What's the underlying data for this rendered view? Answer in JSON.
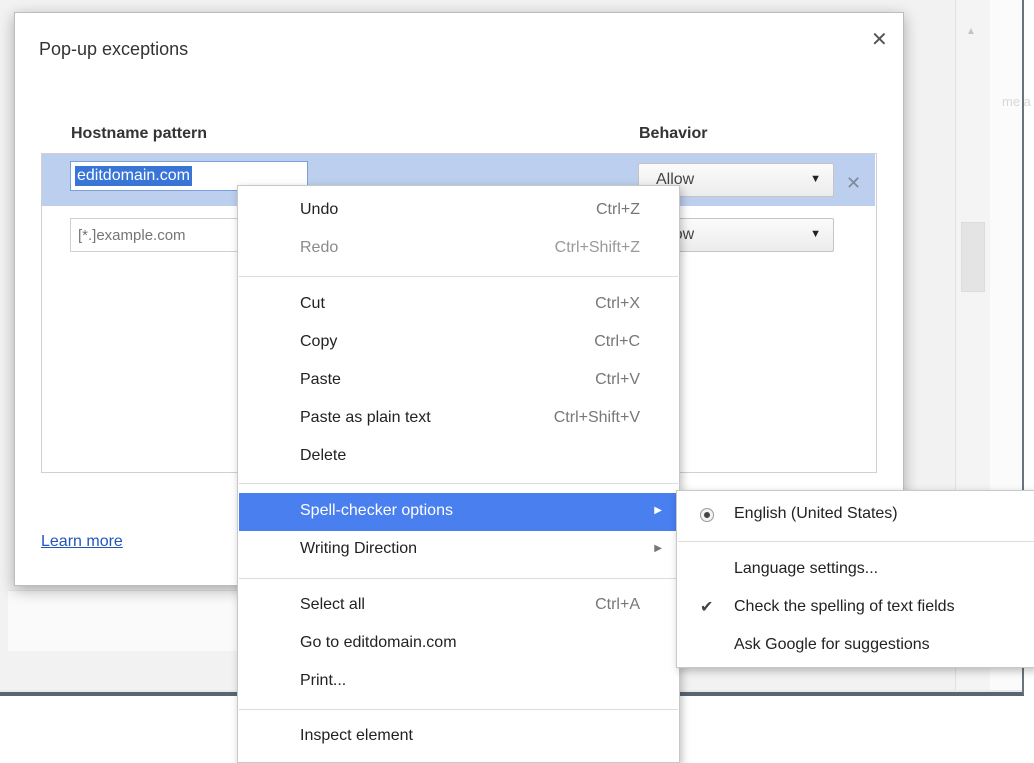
{
  "dialog": {
    "title": "Pop-up exceptions",
    "close_glyph": "✕",
    "columns": {
      "hostname": "Hostname pattern",
      "behavior": "Behavior"
    },
    "rows": [
      {
        "hostname": "editdomain.com",
        "behavior": "Allow",
        "remove_glyph": "✕"
      },
      {
        "hostname": "",
        "behavior": "Allow"
      }
    ],
    "new_host_placeholder": "[*.]example.com",
    "learn_more": "Learn more"
  },
  "context_menu": {
    "items": [
      {
        "label": "Undo",
        "shortcut": "Ctrl+Z",
        "enabled": true
      },
      {
        "label": "Redo",
        "shortcut": "Ctrl+Shift+Z",
        "enabled": false
      },
      {
        "label": "Cut",
        "shortcut": "Ctrl+X",
        "enabled": true
      },
      {
        "label": "Copy",
        "shortcut": "Ctrl+C",
        "enabled": true
      },
      {
        "label": "Paste",
        "shortcut": "Ctrl+V",
        "enabled": true
      },
      {
        "label": "Paste as plain text",
        "shortcut": "Ctrl+Shift+V",
        "enabled": true
      },
      {
        "label": "Delete",
        "shortcut": "",
        "enabled": true
      },
      {
        "label": "Spell-checker options",
        "shortcut": "",
        "enabled": true,
        "submenu": true,
        "highlighted": true
      },
      {
        "label": "Writing Direction",
        "shortcut": "",
        "enabled": true,
        "submenu": true
      },
      {
        "label": "Select all",
        "shortcut": "Ctrl+A",
        "enabled": true
      },
      {
        "label": "Go to editdomain.com",
        "shortcut": "",
        "enabled": true
      },
      {
        "label": "Print...",
        "shortcut": "",
        "enabled": true
      },
      {
        "label": "Inspect element",
        "shortcut": "",
        "enabled": true
      }
    ],
    "submenu_arrow": "▶"
  },
  "spell_submenu": {
    "items": [
      {
        "label": "English (United States)",
        "mark": "radio"
      },
      {
        "label": "Language settings...",
        "mark": ""
      },
      {
        "label": "Check the spelling of text fields",
        "mark": "check",
        "check_glyph": "✔"
      },
      {
        "label": "Ask Google for suggestions",
        "mark": ""
      }
    ]
  },
  "icons": {
    "close": "close-icon",
    "remove_row": "remove-row-icon",
    "dropdown": "chevron-down-icon",
    "submenu": "submenu-arrow-icon",
    "radio": "radio-selected-icon",
    "check": "checkmark-icon"
  },
  "colors": {
    "selection_row": "#bccfee",
    "text_selection": "#3875d7",
    "menu_highlight": "#4a7ff0",
    "link": "#2255bb"
  }
}
